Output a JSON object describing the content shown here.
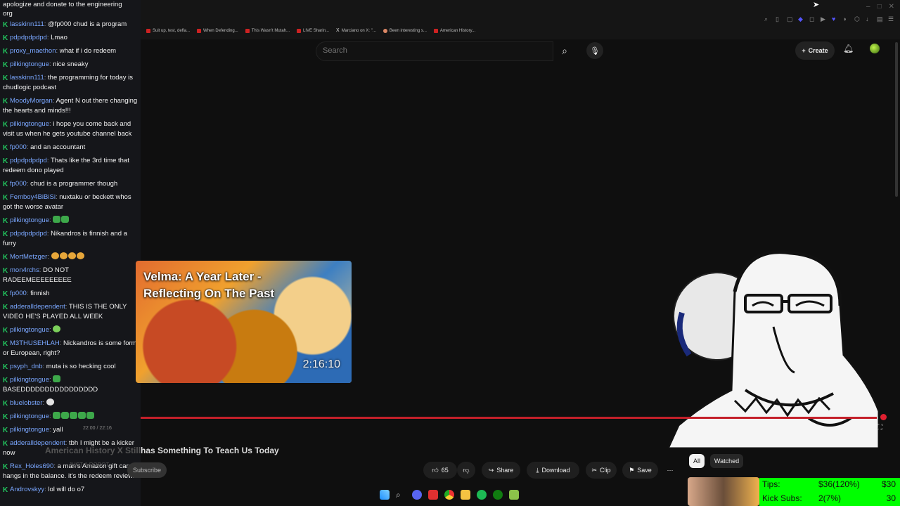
{
  "browser": {
    "bookmarks": [
      {
        "label": "Suit up, test, defla...",
        "fav": "red"
      },
      {
        "label": "When Defending...",
        "fav": "red"
      },
      {
        "label": "This Wasn't Mutah...",
        "fav": "red"
      },
      {
        "label": "LIVE Sharin...",
        "fav": "red"
      },
      {
        "label": "Marciano on X: \"...",
        "fav": "x"
      },
      {
        "label": "Been interesting s...",
        "fav": "o"
      },
      {
        "label": "American History...",
        "fav": "red"
      }
    ]
  },
  "youtube": {
    "search_placeholder": "Search",
    "create_label": "Create",
    "video_title": "has Something To Teach Us Today",
    "video_title_ghost": "American History X Still",
    "channel_ghost": "JUST A ROBOT",
    "subscribe_label": "Subscribe",
    "time_readout": "22:00 / 22:16",
    "like_count": "65",
    "share_label": "Share",
    "download_label": "Download",
    "clip_label": "Clip",
    "save_label": "Save",
    "chip_all": "All",
    "chip_watched": "Watched",
    "thumbnail_title_1": "Velma: A Year Later -",
    "thumbnail_title_2": "Reflecting On The Past",
    "thumbnail_duration": "2:16:10"
  },
  "chat": {
    "top_line_1": "apologize and donate to the engineering",
    "top_line_2": "org",
    "messages": [
      {
        "user": "lasskinn111",
        "text": "@fp000 chud is a program"
      },
      {
        "user": "pdpdpdpdpd",
        "text": "Lmao"
      },
      {
        "user": "proxy_maethon",
        "text": "what if i do redeem"
      },
      {
        "user": "pilkingtongue",
        "text": "nice sneaky"
      },
      {
        "user": "lasskinn111",
        "text": "the programming for today is chudlogic podcast"
      },
      {
        "user": "MoodyMorgan",
        "text": "Agent N out there changing the hearts and minds!!!"
      },
      {
        "user": "pilkingtongue",
        "text": "i hope you come back and visit us when he gets youtube channel back"
      },
      {
        "user": "fp000",
        "text": "and an accountant"
      },
      {
        "user": "pdpdpdpdpd",
        "text": "Thats like the 3rd time that redeem dono played"
      },
      {
        "user": "fp000",
        "text": "chud is a programmer though"
      },
      {
        "user": "Femboy4BiBiSi",
        "text": "nuxtaku or beckett whos got the worse avatar"
      },
      {
        "user": "pilkingtongue",
        "text": "",
        "emotes": [
          "g",
          "g"
        ]
      },
      {
        "user": "pdpdpdpdpd",
        "text": "Nikandros is finnish and a furry"
      },
      {
        "user": "MortMetzger",
        "text": "",
        "emotes": [
          "y",
          "y",
          "y",
          "y"
        ]
      },
      {
        "user": "mon4rchs",
        "text": "DO NOT RADEEMEEEEEEEEE"
      },
      {
        "user": "fp000",
        "text": "finnish"
      },
      {
        "user": "adderalldependent",
        "text": "THIS IS THE ONLY VIDEO HE'S PLAYED ALL WEEK"
      },
      {
        "user": "pilkingtongue",
        "text": "",
        "emotes": [
          "hg"
        ]
      },
      {
        "user": "M3THUSEHLAH",
        "text": "Nickandros is some form or European, right?"
      },
      {
        "user": "psyph_dnb",
        "text": "muta is so hecking cool"
      },
      {
        "user": "pilkingtongue",
        "text": "BASEDDDDDDDDDDDDDDDD",
        "emotes": [
          "g"
        ]
      },
      {
        "user": "bluelobster",
        "text": "",
        "emotes": [
          "p"
        ]
      },
      {
        "user": "pilkingtongue",
        "text": "",
        "emotes": [
          "g",
          "g",
          "g",
          "g",
          "g"
        ]
      },
      {
        "user": "pilkingtongue",
        "text": "yall"
      },
      {
        "user": "adderalldependent",
        "text": "tbh I might be a kicker now"
      },
      {
        "user": "Rex_Holes690",
        "text": "a man's Amazon gift card hangs in the balance. it's the redeem review."
      },
      {
        "user": "Androvskyy",
        "text": "lol will do o7"
      }
    ]
  },
  "overlay": {
    "tips_label": "Tips:",
    "tips_value": "$36(120%)",
    "tips_goal": "$30",
    "subs_label": "Kick Subs:",
    "subs_value": "2(7%)",
    "subs_goal": "30"
  },
  "colors": {
    "progress": "#c4202a",
    "overlay": "#00ff00",
    "username": "#7aa7ff",
    "badge": "#22c55e"
  },
  "player": {
    "progress_fraction": 0.99
  }
}
